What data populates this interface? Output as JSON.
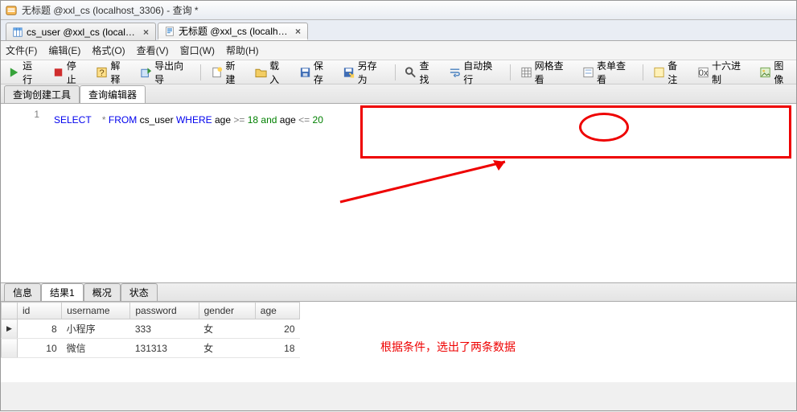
{
  "window": {
    "title": "无标题 @xxl_cs (localhost_3306) - 查询 *"
  },
  "doc_tabs": [
    {
      "label": "cs_user @xxl_cs (localho...",
      "active": false
    },
    {
      "label": "无标题 @xxl_cs (localho...",
      "active": true
    }
  ],
  "menus": {
    "file": "文件(F)",
    "edit": "编辑(E)",
    "format": "格式(O)",
    "view": "查看(V)",
    "window": "窗口(W)",
    "help": "帮助(H)"
  },
  "toolbar": {
    "run": "运行",
    "stop": "停止",
    "explain": "解释",
    "export_wizard": "导出向导",
    "new": "新建",
    "load": "载入",
    "save": "保存",
    "save_as": "另存为",
    "find": "查找",
    "auto_wrap": "自动换行",
    "grid_view": "网格查看",
    "form_view": "表单查看",
    "note": "备注",
    "hex": "十六进制",
    "image": "图像"
  },
  "inner_tabs": {
    "builder": "查询创建工具",
    "editor": "查询编辑器"
  },
  "sql": {
    "line_no": "1",
    "tokens": {
      "select": "SELECT",
      "star": "*",
      "from": "FROM",
      "table": "cs_user",
      "where": "WHERE",
      "col1": "age",
      "op1": ">=",
      "v1": "18",
      "and": "and",
      "col2": "age",
      "op2": "<=",
      "v2": "20"
    }
  },
  "result_tabs": {
    "info": "信息",
    "result1": "结果1",
    "profile": "概况",
    "status": "状态"
  },
  "columns": {
    "id": "id",
    "username": "username",
    "password": "password",
    "gender": "gender",
    "age": "age"
  },
  "rows": [
    {
      "id": "8",
      "username": "小程序",
      "password": "333",
      "gender": "女",
      "age": "20"
    },
    {
      "id": "10",
      "username": "微信",
      "password": "131313",
      "gender": "女",
      "age": "18"
    }
  ],
  "annotation": "根据条件，选出了两条数据",
  "row_marker": "▶"
}
